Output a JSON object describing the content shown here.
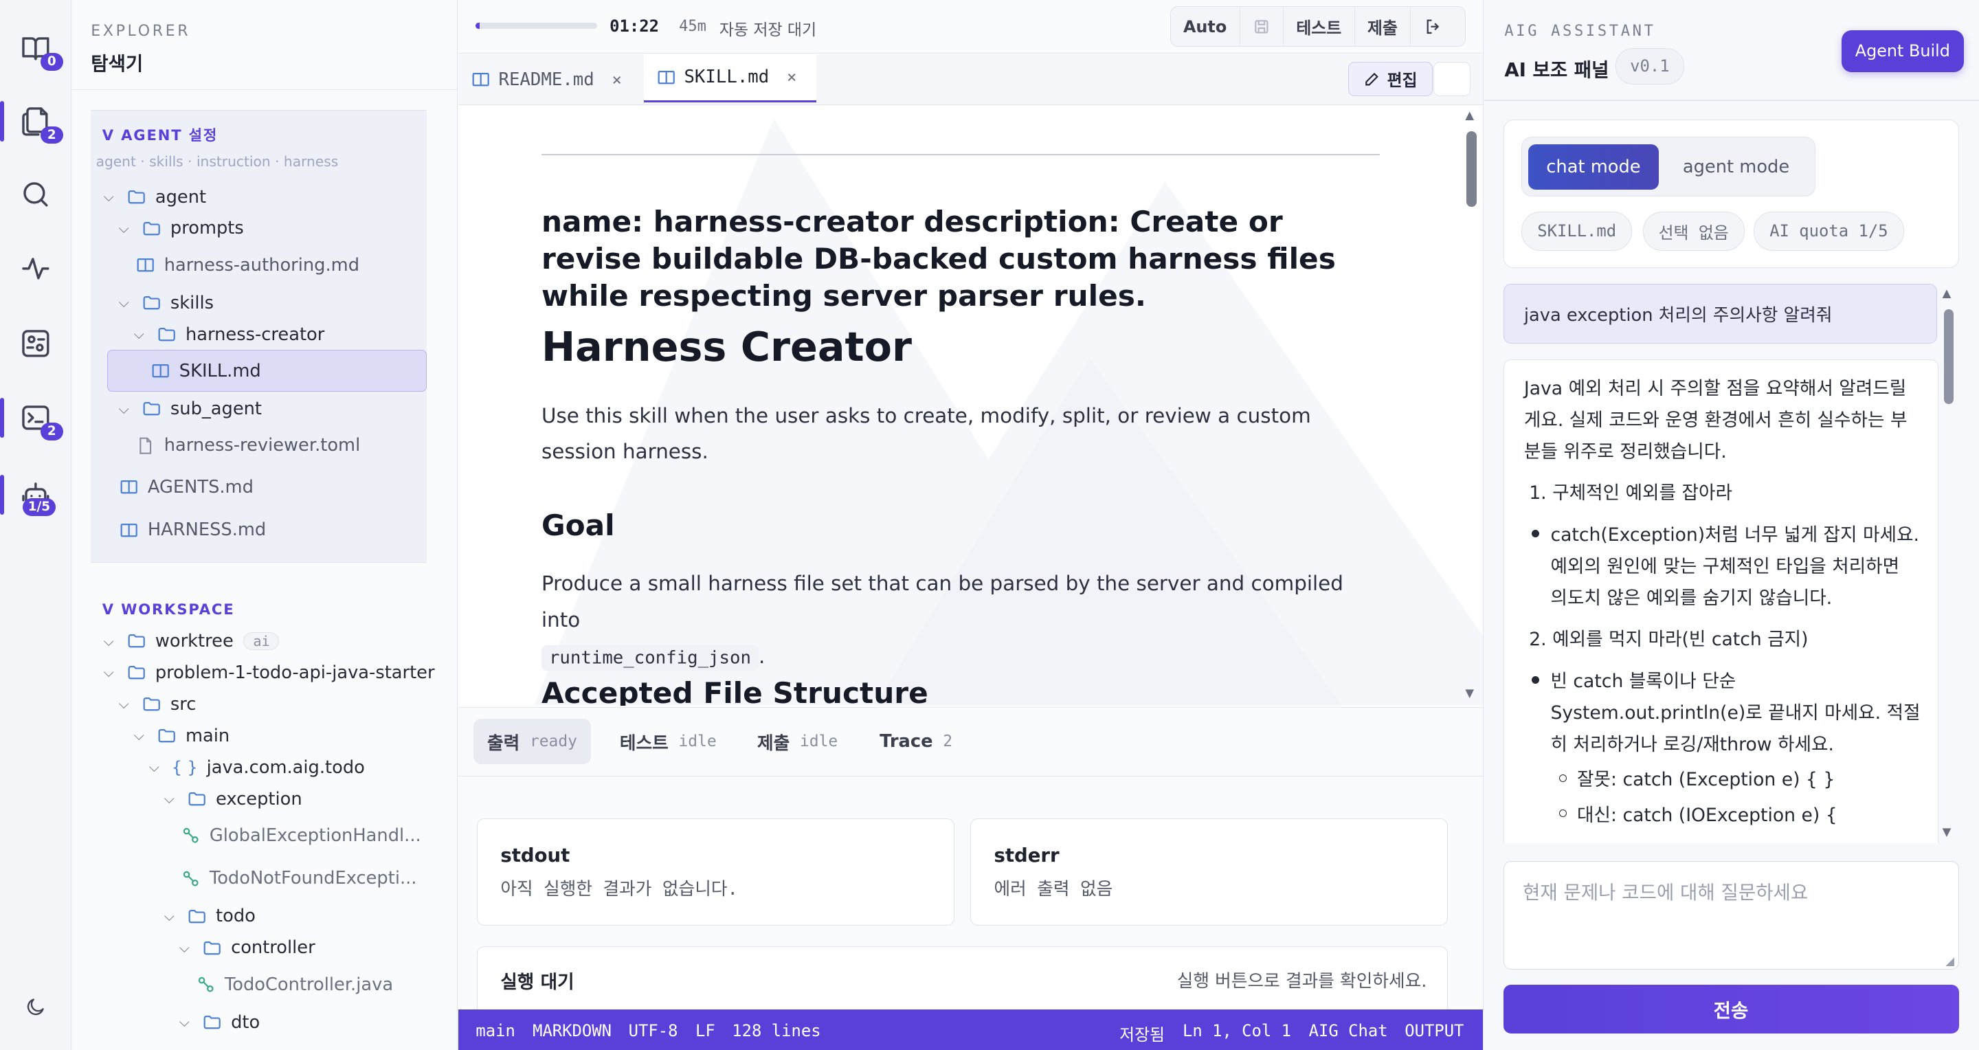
{
  "activity": {
    "badges": {
      "explorer": "0",
      "files": "2",
      "terminal": "2",
      "agent": "1/5"
    }
  },
  "explorer": {
    "kicker": "EXPLORER",
    "title": "탐색기",
    "agent_section": {
      "title": "V AGENT 설정",
      "subtitle": "agent · skills · instruction · harness"
    },
    "agent_tree": {
      "agent": "agent",
      "prompts": "prompts",
      "harness_authoring": "harness-authoring.md",
      "skills": "skills",
      "harness_creator": "harness-creator",
      "skill_md": "SKILL.md",
      "sub_agent": "sub_agent",
      "harness_reviewer": "harness-reviewer.toml",
      "agents_md": "AGENTS.md",
      "harness_md": "HARNESS.md"
    },
    "workspace_section": {
      "title": "V WORKSPACE"
    },
    "workspace_tree": {
      "worktree": "worktree",
      "worktree_chip": "ai",
      "project": "problem-1-todo-api-java-starter",
      "src": "src",
      "main": "main",
      "package": "java.com.aig.todo",
      "exception": "exception",
      "global_exception": "GlobalExceptionHandl...",
      "todo_not_found": "TodoNotFoundExcepti...",
      "todo": "todo",
      "controller": "controller",
      "todo_controller": "TodoController.java",
      "dto": "dto"
    }
  },
  "topbar": {
    "timer": "01:22",
    "duration": "45m",
    "autosave": "자동 저장 대기",
    "progress": 0.03,
    "buttons": {
      "auto": "Auto",
      "test": "테스트",
      "submit": "제출"
    }
  },
  "tabs": [
    {
      "label": "README.md",
      "close": "×"
    },
    {
      "label": "SKILL.md",
      "close": "×"
    }
  ],
  "edit_button": "편집",
  "doc": {
    "frontmatter": "name: harness-creator description: Create or revise buildable DB-backed custom harness files while respecting server parser rules.",
    "h1": "Harness Creator",
    "intro": "Use this skill when the user asks to create, modify, split, or review a custom session harness.",
    "goal_heading": "Goal",
    "goal_text": "Produce a small harness file set that can be parsed by the server and compiled into",
    "goal_code": "runtime_config_json",
    "goal_end": ".",
    "next_heading": "Accepted File Structure"
  },
  "output": {
    "tabs": [
      {
        "label": "출력",
        "status": "ready"
      },
      {
        "label": "테스트",
        "status": "idle"
      },
      {
        "label": "제출",
        "status": "idle"
      },
      {
        "label": "Trace",
        "status": "2"
      }
    ],
    "stdout": {
      "title": "stdout",
      "body": "아직 실행한 결과가 없습니다."
    },
    "stderr": {
      "title": "stderr",
      "body": "에러 출력 없음"
    },
    "run": {
      "title": "실행 대기",
      "hint": "실행 버튼으로 결과를 확인하세요."
    }
  },
  "statusbar": {
    "branch": "main",
    "lang": "MARKDOWN",
    "encoding": "UTF-8",
    "eol": "LF",
    "lines": "128 lines",
    "saved": "저장됨",
    "cursor": "Ln 1, Col 1",
    "chat": "AIG Chat",
    "output": "OUTPUT"
  },
  "ai": {
    "kicker": "AIG ASSISTANT",
    "title": "AI 보조 패널",
    "version": "v0.1",
    "agent_build": "Agent Build",
    "modes": {
      "chat": "chat mode",
      "agent": "agent mode"
    },
    "pills": {
      "file": "SKILL.md",
      "selection": "선택 없음",
      "quota": "AI quota 1/5"
    },
    "user_message": "java exception 처리의 주의사항 알려줘",
    "assistant": {
      "intro1": "Java 예외 처리 시 주의할 점을 요약해서 알려드릴",
      "intro2": "게요. 실제 코드와 운영 환경에서 흔히 실수하는 부",
      "intro3": "분들 위주로 정리했습니다.",
      "item1": "1. 구체적인 예외를 잡아라",
      "b1_1": "catch(Exception)처럼 너무 넓게 잡지 마세요.",
      "b1_2": "예외의 원인에 맞는 구체적인 타입을 처리하면",
      "b1_3": "의도치 않은 예외를 숨기지 않습니다.",
      "item2": "2. 예외를 먹지 마라(빈 catch 금지)",
      "b2_1": "빈 catch 블록이나 단순",
      "b2_2": "System.out.println(e)로 끝내지 마세요. 적절",
      "b2_3": "히 처리하거나 로깅/재throw 하세요.",
      "s1": "잘못: catch (Exception e) { }",
      "s2": "대신: catch (IOException e) {"
    },
    "input_placeholder": "현재 문제나 코드에 대해 질문하세요",
    "send": "전송"
  },
  "colors": {
    "accent": "#5b3fd9",
    "mode_active": "#3f4fb8",
    "selection": "#dcdcf6"
  }
}
